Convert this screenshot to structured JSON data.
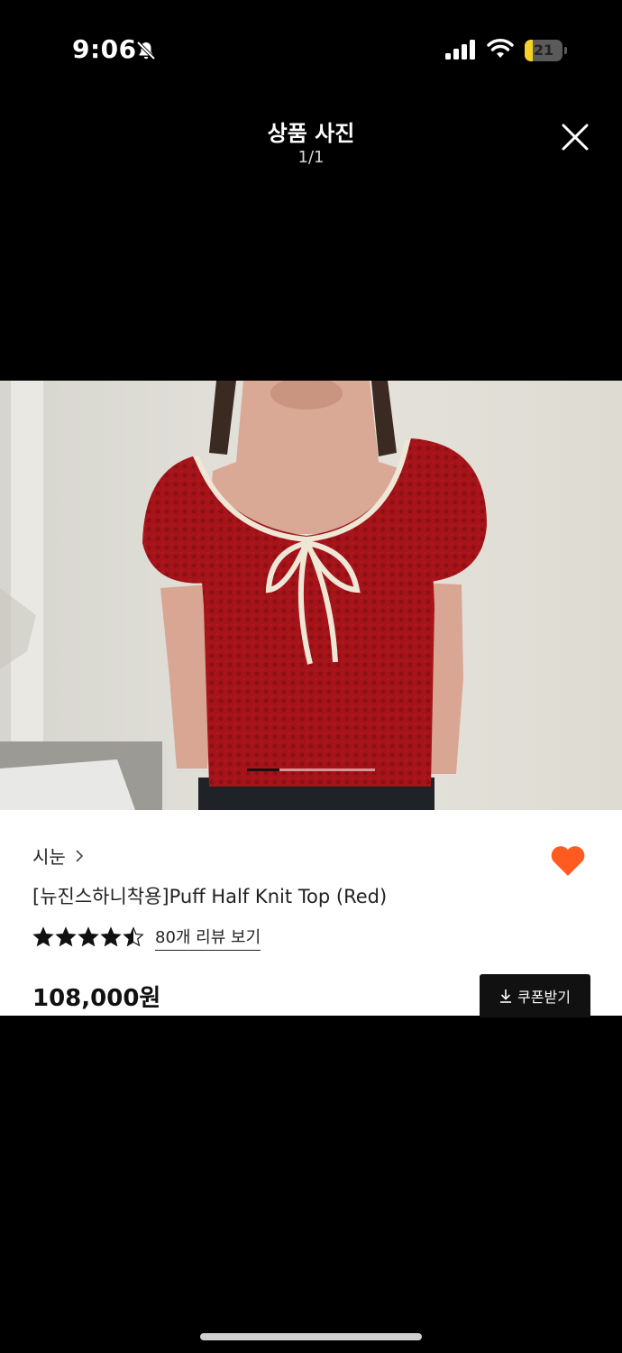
{
  "status_bar": {
    "time": "9:06",
    "battery_level": "21",
    "battery_fraction": 0.21,
    "battery_color": "#f6d12a",
    "icons": [
      "bell-off-icon",
      "signal-icon",
      "wifi-icon",
      "battery-icon"
    ]
  },
  "viewer": {
    "title": "상품 사진",
    "counter": "1/1",
    "close_icon": "close-icon",
    "photo_icon": "product-photo",
    "scroll_progress": 0.25
  },
  "product": {
    "brand": "시눈",
    "name": "[뉴진스하니착용]Puff Half Knit Top (Red)",
    "rating": 4.5,
    "review_link": "80개 리뷰 보기",
    "price": "108,000원",
    "coupon_label": "쿠폰받기",
    "liked": true,
    "heart_color": "#ff5a1f"
  }
}
